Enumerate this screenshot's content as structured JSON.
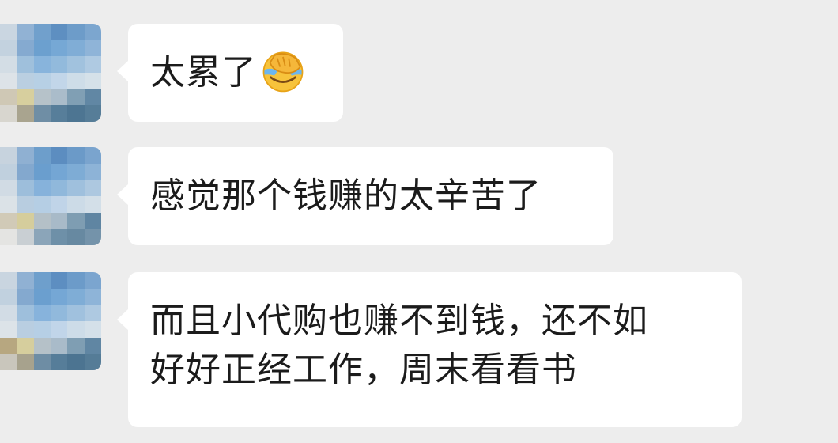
{
  "messages": [
    {
      "sender": "contact",
      "text": "太累了",
      "emoji": "facepalm-crying-emoji"
    },
    {
      "sender": "contact",
      "text": "感觉那个钱赚的太辛苦了"
    },
    {
      "sender": "contact",
      "text": "而且小代购也赚不到钱，还不如\n好好正经工作，周末看看书"
    }
  ],
  "colors": {
    "background": "#ededed",
    "bubble": "#ffffff",
    "text": "#1b1b1b"
  }
}
